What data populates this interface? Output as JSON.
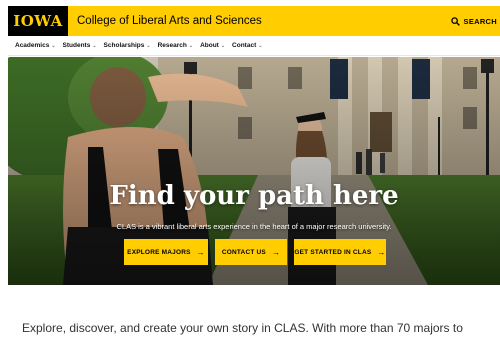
{
  "header": {
    "logo_text": "IOWA",
    "college_name": "College of Liberal Arts and Sciences",
    "search_label": "SEARCH"
  },
  "nav": {
    "items": [
      {
        "label": "Academics"
      },
      {
        "label": "Students"
      },
      {
        "label": "Scholarships"
      },
      {
        "label": "Research"
      },
      {
        "label": "About"
      },
      {
        "label": "Contact"
      }
    ]
  },
  "hero": {
    "title": "Find your path here",
    "subtitle": "CLAS is a vibrant liberal arts experience in the heart of a major research university.",
    "buttons": [
      {
        "label": "EXPLORE MAJORS"
      },
      {
        "label": "CONTACT US"
      },
      {
        "label": "GET STARTED IN CLAS"
      }
    ]
  },
  "intro": {
    "line1": "Explore, discover, and create your own story in CLAS. With more than 70 majors to"
  },
  "colors": {
    "brand_gold": "#FFCD00",
    "brand_black": "#000000"
  }
}
